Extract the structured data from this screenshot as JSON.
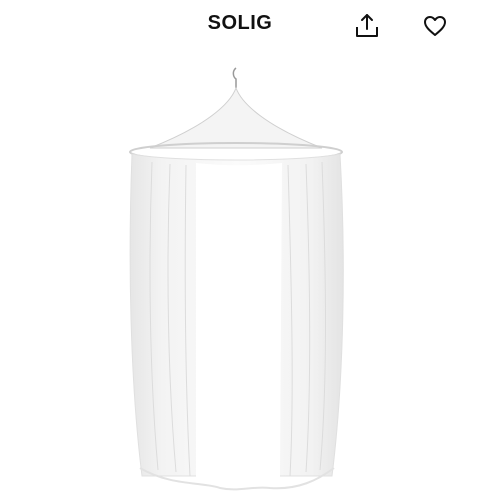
{
  "header": {
    "title": "SOLIG",
    "share_icon": "share-icon",
    "favorite_icon": "heart-icon"
  },
  "product_image": {
    "subject": "canopy"
  }
}
